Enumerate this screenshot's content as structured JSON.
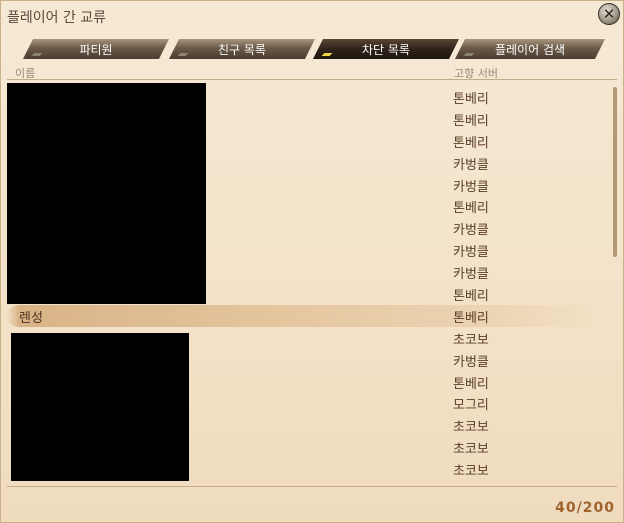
{
  "window": {
    "title": "플레이어 간 교류"
  },
  "tabs": [
    {
      "label": "파티원",
      "active": false
    },
    {
      "label": "친구 목록",
      "active": false
    },
    {
      "label": "차단 목록",
      "active": true
    },
    {
      "label": "플레이어 검색",
      "active": false
    }
  ],
  "columns": {
    "name": "이름",
    "server": "고향 서버"
  },
  "rows": [
    {
      "name": "",
      "server": "톤베리"
    },
    {
      "name": "",
      "server": "톤베리"
    },
    {
      "name": "",
      "server": "톤베리"
    },
    {
      "name": "",
      "server": "카벙클"
    },
    {
      "name": "",
      "server": "카벙클"
    },
    {
      "name": "",
      "server": "톤베리"
    },
    {
      "name": "",
      "server": "카벙클"
    },
    {
      "name": "",
      "server": "카벙클"
    },
    {
      "name": "",
      "server": "카벙클"
    },
    {
      "name": "",
      "server": "톤베리"
    },
    {
      "name": "렌성",
      "server": "톤베리",
      "selected": true
    },
    {
      "name": "",
      "server": "초코보"
    },
    {
      "name": "",
      "server": "카벙클"
    },
    {
      "name": "",
      "server": "톤베리"
    },
    {
      "name": "",
      "server": "모그리"
    },
    {
      "name": "",
      "server": "초코보"
    },
    {
      "name": "",
      "server": "초코보"
    },
    {
      "name": "",
      "server": "초코보"
    }
  ],
  "footer": {
    "count": "40/200"
  },
  "colors": {
    "accent": "#a0632d",
    "text": "#5a3d28",
    "tab_active_marker": "#f3d24a"
  },
  "icons": {
    "close": "close-icon",
    "tab_marker": "tab-marker-icon"
  }
}
